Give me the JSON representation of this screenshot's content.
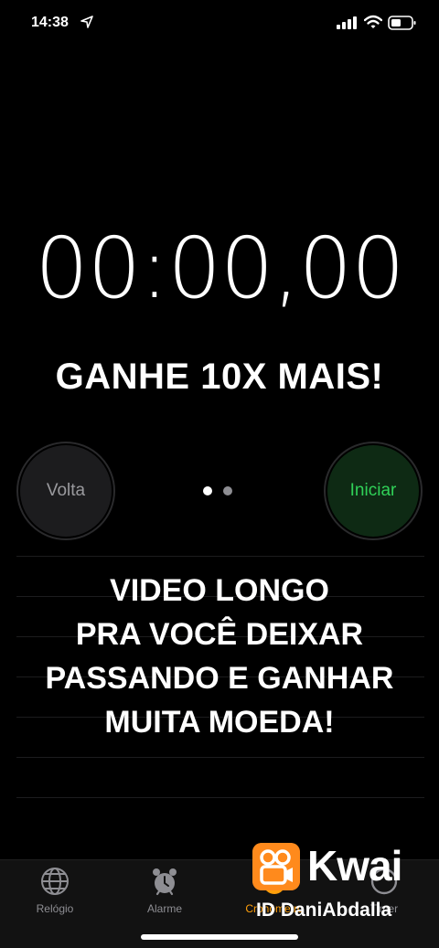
{
  "status_bar": {
    "time": "14:38"
  },
  "stopwatch": {
    "display": "00:00,00"
  },
  "overlay": {
    "headline": "GANHE 10X MAIS!",
    "body_lines": [
      "VIDEO LONGO",
      "PRA VOCÊ DEIXAR",
      "PASSANDO E GANHAR",
      "MUITA MOEDA!"
    ]
  },
  "controls": {
    "lap_label": "Volta",
    "start_label": "Iniciar"
  },
  "pager": {
    "current": 1,
    "total": 2
  },
  "tabs": [
    {
      "label": "Relógio",
      "icon": "globe-icon"
    },
    {
      "label": "Alarme",
      "icon": "alarm-clock-icon"
    },
    {
      "label": "Cronômetro",
      "icon": "stopwatch-icon",
      "active": true
    },
    {
      "label": "Timer",
      "icon": "timer-icon"
    }
  ],
  "watermark": {
    "brand": "Kwai",
    "id_text": "ID DaniAbdalla"
  },
  "colors": {
    "accent_green": "#30d158",
    "accent_orange": "#ff9f0a",
    "brand_orange": "#ff8a1c"
  }
}
